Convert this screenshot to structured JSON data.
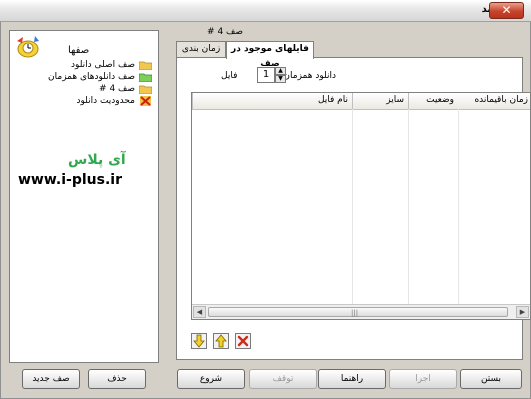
{
  "window": {
    "title": "زمان بند",
    "close_label": "✕"
  },
  "queues": {
    "title": "صفها",
    "items": [
      {
        "label": "صف اصلی دانلود",
        "icon": "folder-icon",
        "color": "#e8c040"
      },
      {
        "label": "صف دانلودهای همزمان",
        "icon": "folder-green-icon",
        "color": "#3aa83a"
      },
      {
        "label": "صف 4 #",
        "icon": "folder-icon",
        "color": "#e8c040"
      },
      {
        "label": "محدودیت دانلود",
        "icon": "block-icon",
        "color": "#d03020"
      }
    ]
  },
  "branding": {
    "name": "آی پلاس",
    "url": "www.i-plus.ir",
    "color": "#2fa84f"
  },
  "left_buttons": {
    "delete": "حذف",
    "new_queue": "صف جدید"
  },
  "current_queue": {
    "label": "صف 4 #"
  },
  "tabs": [
    {
      "label": "فایلهای موجود در صف",
      "active": true
    },
    {
      "label": "زمان بندی",
      "active": false
    }
  ],
  "simultaneous": {
    "label": "دانلود همزمان",
    "value": "1",
    "unit": "فایل"
  },
  "table": {
    "columns": [
      "نام فایل",
      "سایز",
      "وضعیت",
      "زمان باقیمانده"
    ]
  },
  "bottom_buttons": {
    "start": "شروع",
    "stop": "توقف",
    "help": "راهنما",
    "run": "اجرا",
    "close": "بستن"
  },
  "icons": {
    "move_down": "arrow-down-icon",
    "move_up": "arrow-up-icon",
    "remove": "delete-icon"
  }
}
